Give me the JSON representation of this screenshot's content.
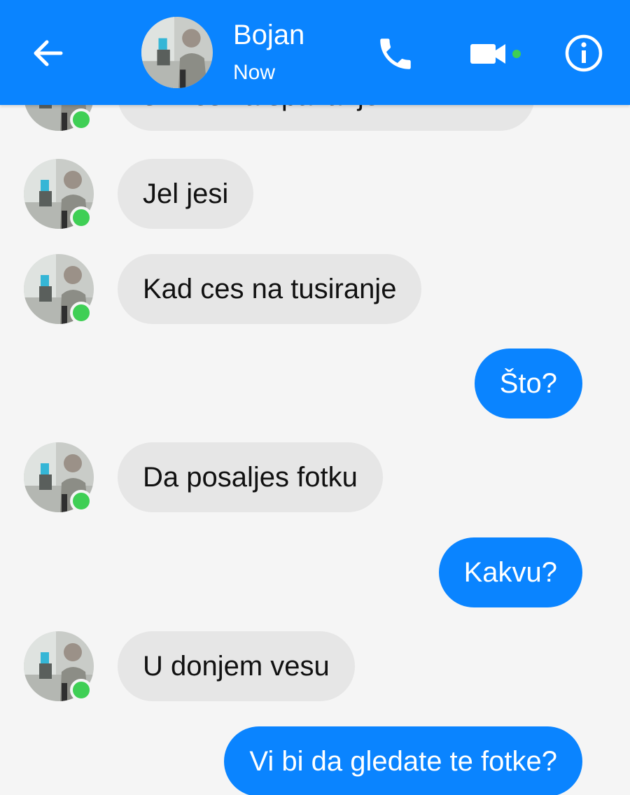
{
  "header": {
    "contact_name": "Bojan",
    "status": "Now",
    "back_icon": "arrow-left-icon",
    "call_icon": "phone-icon",
    "video_icon": "video-camera-icon",
    "info_icon": "info-icon",
    "bar_color": "#0a84ff",
    "online_color": "#3fcf55"
  },
  "messages": [
    {
      "direction": "incoming",
      "text": "skines za spavanje",
      "partially_visible": true
    },
    {
      "direction": "incoming",
      "text": "Jel jesi"
    },
    {
      "direction": "incoming",
      "text": "Kad ces na tusiranje"
    },
    {
      "direction": "outgoing",
      "text": "Što?"
    },
    {
      "direction": "incoming",
      "text": "Da posaljes fotku"
    },
    {
      "direction": "outgoing",
      "text": "Kakvu?"
    },
    {
      "direction": "incoming",
      "text": "U donjem vesu"
    },
    {
      "direction": "outgoing",
      "text": "Vi bi da gledate te fotke?"
    }
  ],
  "colors": {
    "outgoing_bubble": "#0a84ff",
    "incoming_bubble": "#e6e6e6",
    "background": "#f5f5f5"
  }
}
